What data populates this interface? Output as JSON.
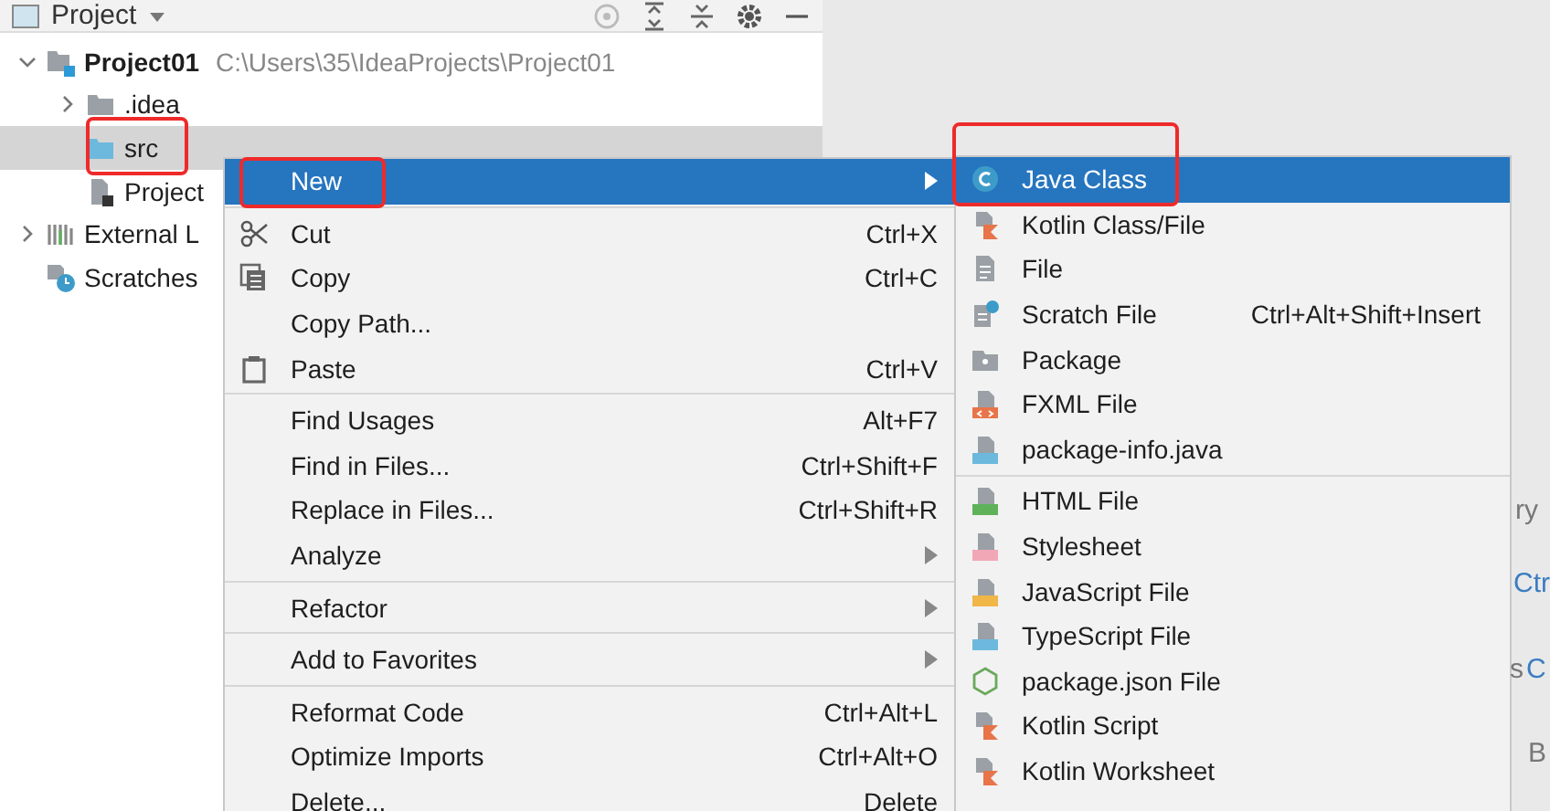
{
  "tool_window": {
    "title": "Project"
  },
  "tree": [
    {
      "label": "Project01",
      "path": "C:\\Users\\35\\IdeaProjects\\Project01",
      "kind": "module",
      "expanded": true,
      "selected": false,
      "highlighted": false,
      "children": [
        {
          "label": ".idea",
          "kind": "folder",
          "expanded": false,
          "selected": false,
          "highlighted": false
        },
        {
          "label": "src",
          "kind": "source-folder",
          "selected": true,
          "highlighted": true
        },
        {
          "label": "Project",
          "kind": "iml",
          "selected": false,
          "highlighted": false
        }
      ]
    },
    {
      "label": "External L",
      "kind": "libraries",
      "expanded": false,
      "selected": false,
      "highlighted": false
    },
    {
      "label": "Scratches",
      "kind": "scratches",
      "selected": false,
      "highlighted": false
    }
  ],
  "context_menu": {
    "groups": [
      [
        {
          "label": "New",
          "kind": "none",
          "submenu": true,
          "selected": true,
          "highlighted": true
        }
      ],
      [
        {
          "label": "Cut",
          "shortcut": "Ctrl+X",
          "kind": "scissors",
          "submenu": false,
          "selected": false,
          "highlighted": false
        },
        {
          "label": "Copy",
          "shortcut": "Ctrl+C",
          "kind": "copy",
          "submenu": false,
          "selected": false,
          "highlighted": false
        },
        {
          "label": "Copy Path...",
          "kind": "none",
          "submenu": false,
          "selected": false,
          "highlighted": false
        },
        {
          "label": "Paste",
          "shortcut": "Ctrl+V",
          "kind": "paste",
          "submenu": false,
          "selected": false,
          "highlighted": false
        }
      ],
      [
        {
          "label": "Find Usages",
          "shortcut": "Alt+F7",
          "kind": "none",
          "submenu": false,
          "selected": false,
          "highlighted": false
        },
        {
          "label": "Find in Files...",
          "shortcut": "Ctrl+Shift+F",
          "kind": "none",
          "submenu": false,
          "selected": false,
          "highlighted": false
        },
        {
          "label": "Replace in Files...",
          "shortcut": "Ctrl+Shift+R",
          "kind": "none",
          "submenu": false,
          "selected": false,
          "highlighted": false
        },
        {
          "label": "Analyze",
          "kind": "none",
          "submenu": true,
          "selected": false,
          "highlighted": false
        }
      ],
      [
        {
          "label": "Refactor",
          "kind": "none",
          "submenu": true,
          "selected": false,
          "highlighted": false
        }
      ],
      [
        {
          "label": "Add to Favorites",
          "kind": "none",
          "submenu": true,
          "selected": false,
          "highlighted": false
        }
      ],
      [
        {
          "label": "Reformat Code",
          "shortcut": "Ctrl+Alt+L",
          "kind": "none",
          "submenu": false,
          "selected": false,
          "highlighted": false
        },
        {
          "label": "Optimize Imports",
          "shortcut": "Ctrl+Alt+O",
          "kind": "none",
          "submenu": false,
          "selected": false,
          "highlighted": false
        },
        {
          "label": "Delete...",
          "shortcut": "Delete",
          "kind": "none",
          "submenu": false,
          "selected": false,
          "highlighted": false
        }
      ]
    ]
  },
  "new_submenu": {
    "groups": [
      [
        {
          "label": "Java Class",
          "kind": "java-class",
          "selected": true,
          "highlighted": true
        },
        {
          "label": "Kotlin Class/File",
          "kind": "kotlin",
          "selected": false,
          "highlighted": false
        },
        {
          "label": "File",
          "kind": "file",
          "selected": false,
          "highlighted": false
        },
        {
          "label": "Scratch File",
          "shortcut": "Ctrl+Alt+Shift+Insert",
          "kind": "scratch",
          "selected": false,
          "highlighted": false
        },
        {
          "label": "Package",
          "kind": "package",
          "selected": false,
          "highlighted": false
        },
        {
          "label": "FXML File",
          "kind": "fxml",
          "selected": false,
          "highlighted": false
        },
        {
          "label": "package-info.java",
          "kind": "package-info",
          "selected": false,
          "highlighted": false
        }
      ],
      [
        {
          "label": "HTML File",
          "kind": "html",
          "selected": false,
          "highlighted": false
        },
        {
          "label": "Stylesheet",
          "kind": "css",
          "selected": false,
          "highlighted": false
        },
        {
          "label": "JavaScript File",
          "kind": "js",
          "selected": false,
          "highlighted": false
        },
        {
          "label": "TypeScript File",
          "kind": "ts",
          "selected": false,
          "highlighted": false
        },
        {
          "label": "package.json File",
          "kind": "node",
          "selected": false,
          "highlighted": false
        },
        {
          "label": "Kotlin Script",
          "kind": "kotlin",
          "selected": false,
          "highlighted": false
        },
        {
          "label": "Kotlin Worksheet",
          "kind": "kotlin",
          "selected": false,
          "highlighted": false
        }
      ]
    ]
  },
  "editor_hints": [
    {
      "text": "ry",
      "kind": "label"
    },
    {
      "text": "Ctr",
      "kind": "shortcut"
    },
    {
      "text": "s",
      "kind": "label"
    },
    {
      "text": "C",
      "kind": "shortcut"
    },
    {
      "text": "B",
      "kind": "label"
    }
  ]
}
